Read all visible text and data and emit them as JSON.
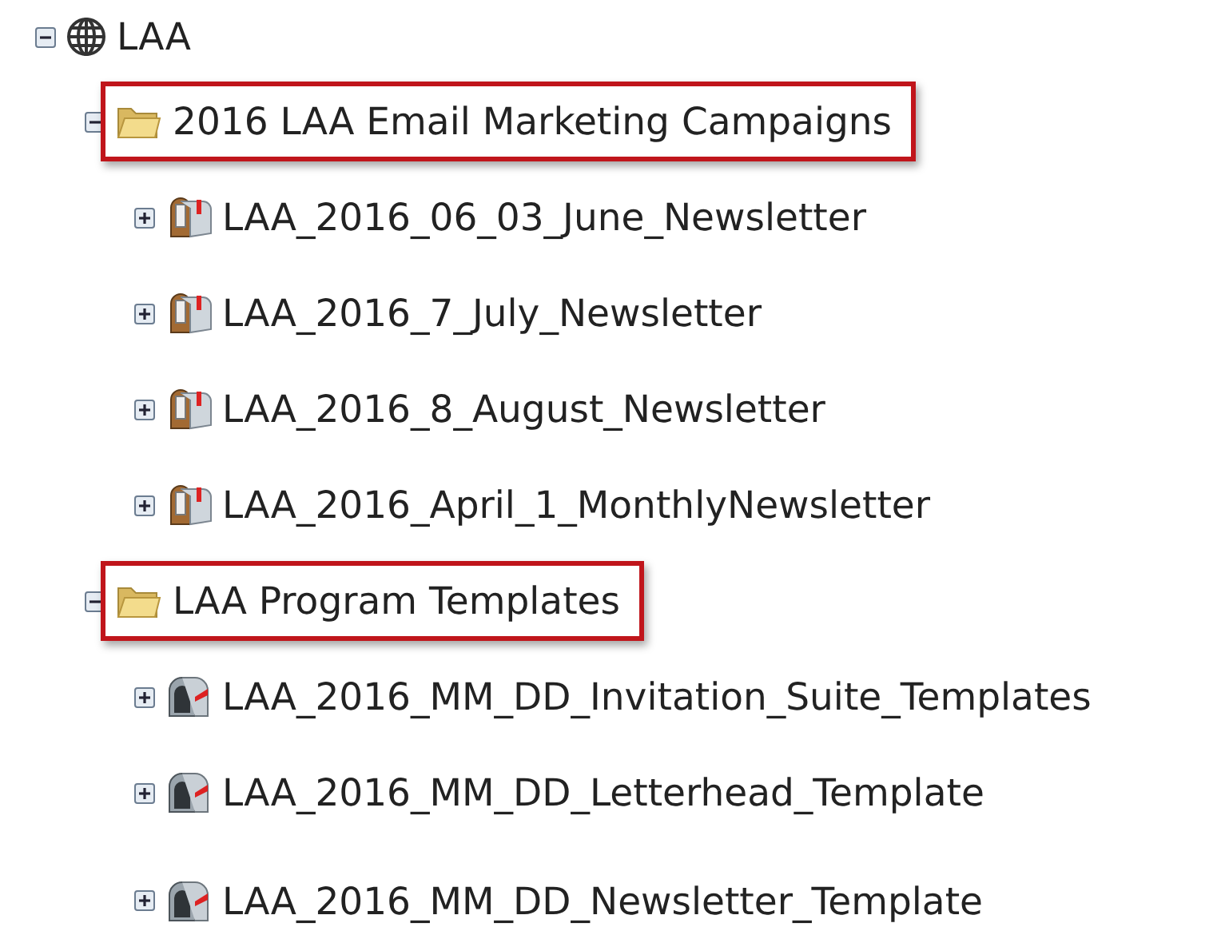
{
  "tree": [
    {
      "label": "LAA",
      "kind": "workspace",
      "expanded": true,
      "highlighted": false,
      "children": [
        {
          "label": "2016 LAA Email Marketing Campaigns",
          "kind": "folder",
          "expanded": true,
          "highlighted": true,
          "children": [
            {
              "label": "LAA_2016_06_03_June_Newsletter",
              "kind": "email-program",
              "expanded": false,
              "highlighted": false
            },
            {
              "label": "LAA_2016_7_July_Newsletter",
              "kind": "email-program",
              "expanded": false,
              "highlighted": false
            },
            {
              "label": "LAA_2016_8_August_Newsletter",
              "kind": "email-program",
              "expanded": false,
              "highlighted": false
            },
            {
              "label": "LAA_2016_April_1_MonthlyNewsletter",
              "kind": "email-program",
              "expanded": false,
              "highlighted": false
            }
          ]
        },
        {
          "label": "LAA Program Templates",
          "kind": "folder",
          "expanded": true,
          "highlighted": true,
          "children": [
            {
              "label": "LAA_2016_MM_DD_Invitation_Suite_Templates",
              "kind": "program",
              "expanded": false,
              "highlighted": false
            },
            {
              "label": "LAA_2016_MM_DD_Letterhead_Template",
              "kind": "program",
              "expanded": false,
              "highlighted": false
            },
            {
              "label": "LAA_2016_MM_DD_Newsletter_Template",
              "kind": "program",
              "expanded": false,
              "highlighted": false
            }
          ]
        }
      ]
    }
  ]
}
